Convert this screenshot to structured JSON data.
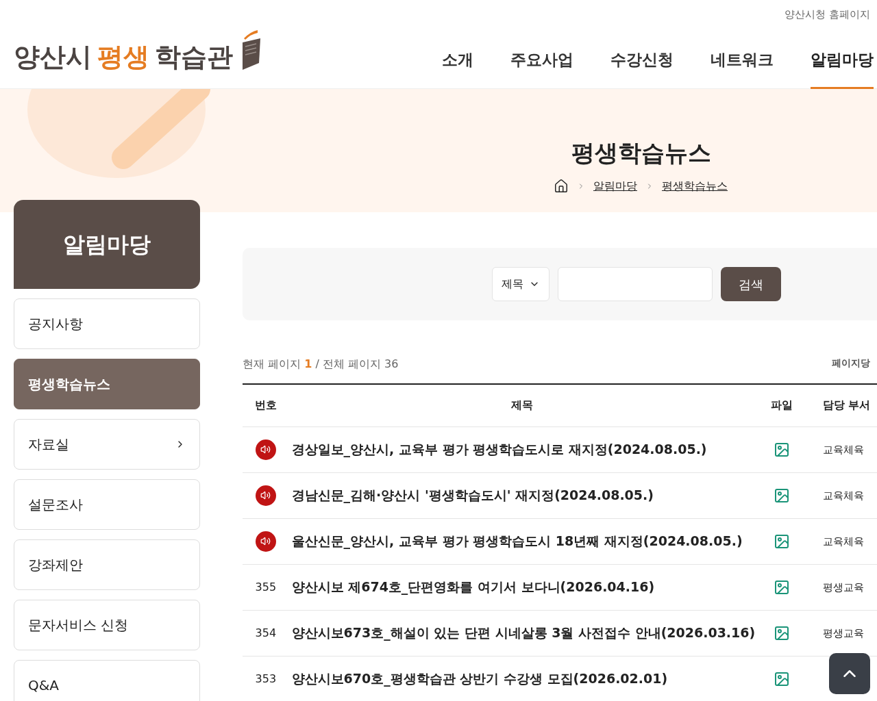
{
  "top_link": "양산시청 홈페이지",
  "logo": {
    "part_1": "양산시",
    "part_2": "평생",
    "part_3": "학습관"
  },
  "nav": [
    {
      "label": "소개",
      "selected": false
    },
    {
      "label": "주요사업",
      "selected": false
    },
    {
      "label": "수강신청",
      "selected": false
    },
    {
      "label": "네트워크",
      "selected": false
    },
    {
      "label": "알림마당",
      "selected": true
    }
  ],
  "hero": {
    "title": "평생학습뉴스",
    "breadcrumb": [
      "알림마당",
      "평생학습뉴스"
    ]
  },
  "sidebar": {
    "title": "알림마당",
    "items": [
      {
        "label": "공지사항",
        "selected": false,
        "has_submenu": false
      },
      {
        "label": "평생학습뉴스",
        "selected": true,
        "has_submenu": false
      },
      {
        "label": "자료실",
        "selected": false,
        "has_submenu": true
      },
      {
        "label": "설문조사",
        "selected": false,
        "has_submenu": false
      },
      {
        "label": "강좌제안",
        "selected": false,
        "has_submenu": false
      },
      {
        "label": "문자서비스 신청",
        "selected": false,
        "has_submenu": false
      },
      {
        "label": "Q&A",
        "selected": false,
        "has_submenu": false
      }
    ]
  },
  "search": {
    "select": "제목",
    "button": "검색"
  },
  "page_info": {
    "current_label": "현재 페이지",
    "current": "1",
    "total": "/ 전체 페이지 36",
    "per_page": "페이지당"
  },
  "table": {
    "columns": [
      "번호",
      "제목",
      "파일",
      "담당 부서"
    ],
    "rows": [
      {
        "kind": "notice",
        "title": "경상일보_양산시, 교육부 평가 평생학습도시로 재지정(2024.08.05.)",
        "dept": "교육체육"
      },
      {
        "kind": "notice",
        "title": "경남신문_김해·양산시 '평생학습도시' 재지정(2024.08.05.)",
        "dept": "교육체육"
      },
      {
        "kind": "notice",
        "title": "울산신문_양산시, 교육부 평가 평생학습도시 18년째 재지정(2024.08.05.)",
        "dept": "교육체육"
      },
      {
        "kind": "numbered",
        "number": "355",
        "title": "양산시보 제674호_단편영화를 여기서 보다니(2026.04.16)",
        "dept": "평생교육"
      },
      {
        "kind": "numbered",
        "number": "354",
        "title": "양산시보673호_해설이 있는 단편 시네살롱 3월 사전접수 안내(2026.03.16)",
        "dept": "평생교육"
      },
      {
        "kind": "numbered",
        "number": "353",
        "title": "양산시보670호_평생학습관 상반기 수강생 모집(2026.02.01)"
      }
    ]
  }
}
